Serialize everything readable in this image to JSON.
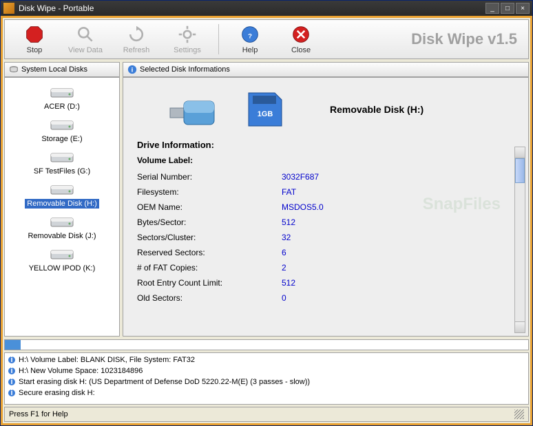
{
  "window": {
    "title": "Disk Wipe  - Portable"
  },
  "brand": "Disk Wipe v1.5",
  "toolbar": {
    "stop": "Stop",
    "view_data": "View Data",
    "refresh": "Refresh",
    "settings": "Settings",
    "help": "Help",
    "close": "Close"
  },
  "panels": {
    "left_header": "System Local Disks",
    "right_header": "Selected Disk Informations"
  },
  "disks": [
    {
      "label": "ACER (D:)"
    },
    {
      "label": "Storage (E:)"
    },
    {
      "label": "SF TestFiles (G:)"
    },
    {
      "label": "Removable Disk (H:)"
    },
    {
      "label": "Removable Disk (J:)"
    },
    {
      "label": "YELLOW IPOD (K:)"
    }
  ],
  "drive": {
    "title": "Removable Disk  (H:)",
    "section": "Drive Information:",
    "volume_label_head": "Volume Label:",
    "rows": [
      {
        "k": "Serial Number:",
        "v": "3032F687"
      },
      {
        "k": "Filesystem:",
        "v": "FAT"
      },
      {
        "k": "OEM Name:",
        "v": "MSDOS5.0"
      },
      {
        "k": "Bytes/Sector:",
        "v": "512"
      },
      {
        "k": "Sectors/Cluster:",
        "v": "32"
      },
      {
        "k": "Reserved Sectors:",
        "v": "6"
      },
      {
        "k": "# of FAT Copies:",
        "v": "2"
      },
      {
        "k": "Root Entry Count Limit:",
        "v": "512"
      },
      {
        "k": "Old Sectors:",
        "v": "0"
      }
    ]
  },
  "log": [
    "H:\\ Volume Label: BLANK DISK, File System: FAT32",
    "H:\\ New Volume Space: 1023184896",
    "Start erasing disk H: (US Department of Defense DoD 5220.22-M(E) (3 passes - slow))",
    "Secure erasing disk H:"
  ],
  "status": "Press F1 for Help",
  "watermark": "SnapFiles"
}
